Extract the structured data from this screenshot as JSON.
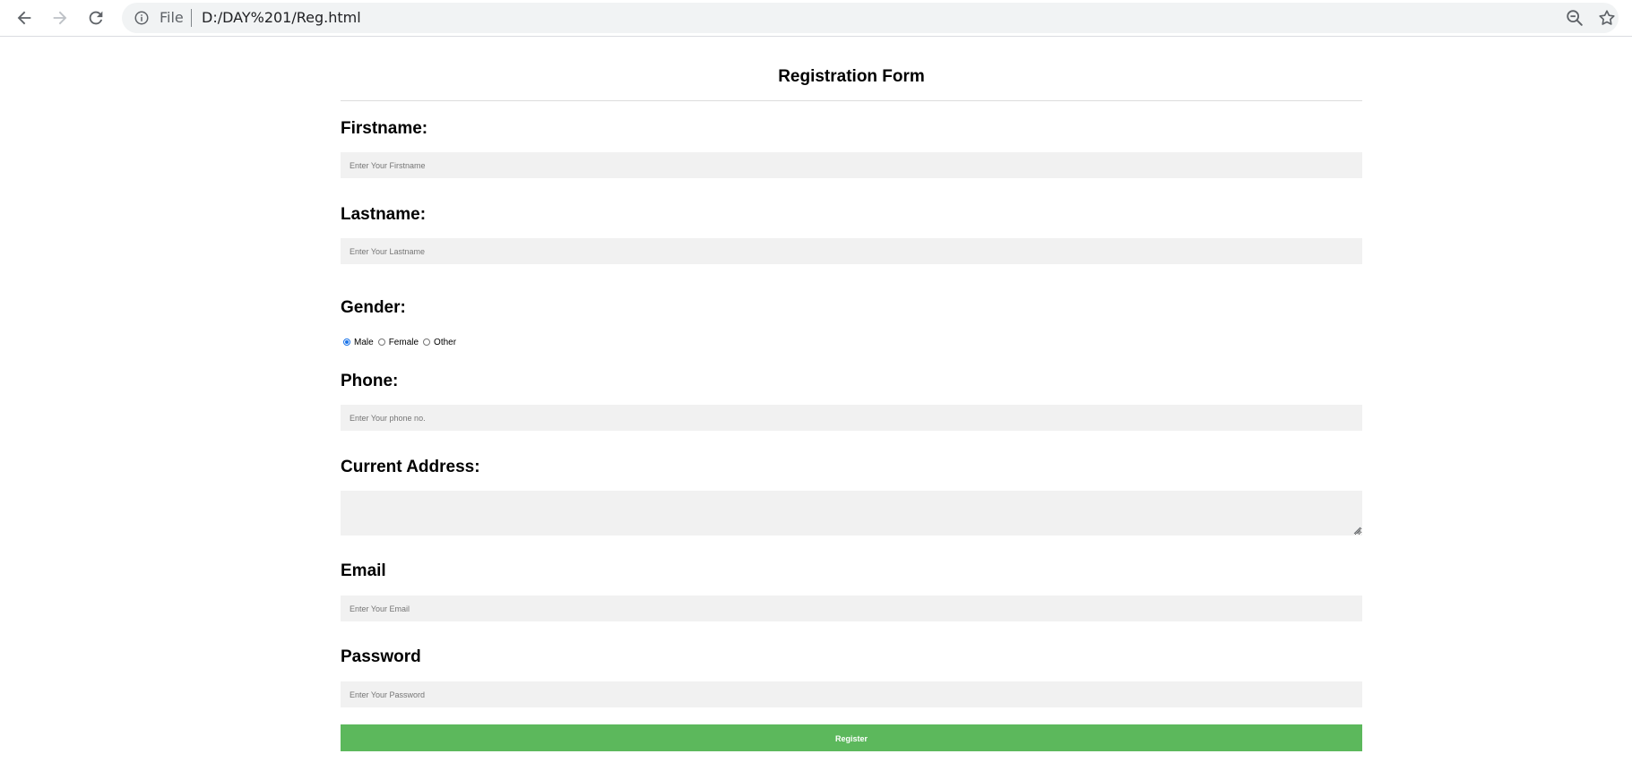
{
  "browser": {
    "scheme_label": "File",
    "url": "D:/DAY%201/Reg.html",
    "icons": {
      "back": "back-arrow-icon",
      "forward": "forward-arrow-icon",
      "reload": "reload-icon",
      "info": "info-icon",
      "zoom": "zoom-out-icon",
      "bookmark": "star-icon"
    }
  },
  "form": {
    "title": "Registration Form",
    "firstname": {
      "label": "Firstname:",
      "placeholder": "Enter Your Firstname",
      "value": ""
    },
    "lastname": {
      "label": "Lastname:",
      "placeholder": "Enter Your Lastname",
      "value": ""
    },
    "gender": {
      "label": "Gender:",
      "options": [
        "Male",
        "Female",
        "Other"
      ],
      "selected": "Male"
    },
    "phone": {
      "label": "Phone:",
      "placeholder": "Enter Your phone no.",
      "value": ""
    },
    "address": {
      "label": "Current Address:",
      "value": ""
    },
    "email": {
      "label": "Email",
      "placeholder": "Enter Your Email",
      "value": ""
    },
    "password": {
      "label": "Password",
      "placeholder": "Enter Your Password",
      "value": ""
    },
    "submit_label": "Register"
  },
  "colors": {
    "button_bg": "#5cb85c",
    "input_bg": "#f1f1f1",
    "radio_accent": "#1a73e8"
  }
}
